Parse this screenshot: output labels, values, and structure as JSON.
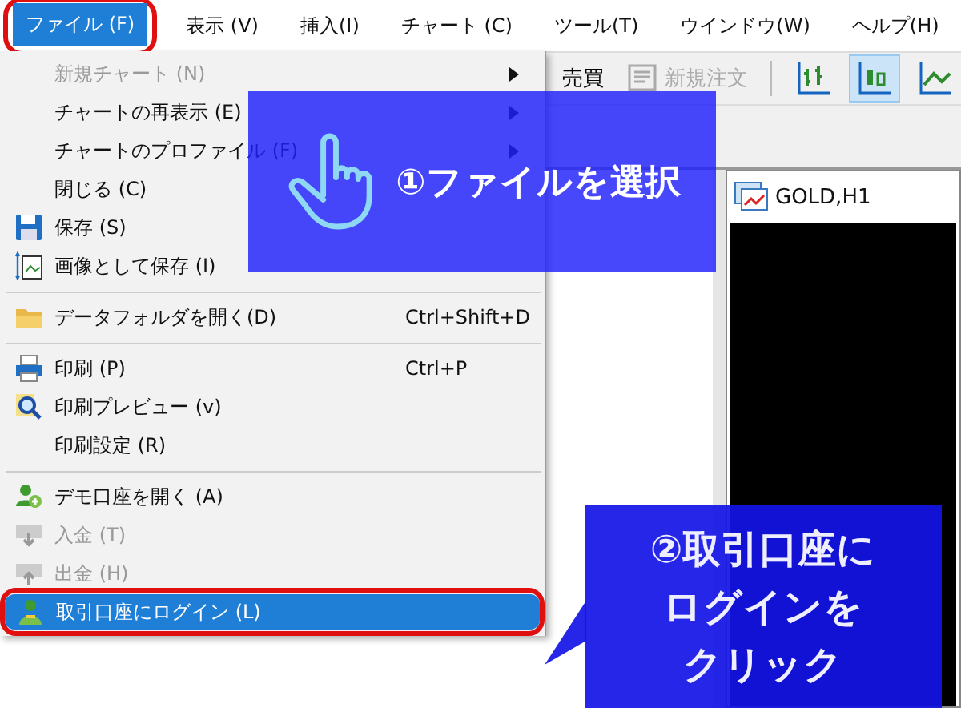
{
  "menubar": [
    {
      "label": "ファイル (F)",
      "selected": true,
      "annotated": true
    },
    {
      "label": "表示 (V)",
      "selected": false,
      "annotated": false
    },
    {
      "label": "挿入(I)",
      "selected": false,
      "annotated": false
    },
    {
      "label": "チャート (C)",
      "selected": false,
      "annotated": false
    },
    {
      "label": "ツール(T)",
      "selected": false,
      "annotated": false
    },
    {
      "label": "ウインドウ(W)",
      "selected": false,
      "annotated": false
    },
    {
      "label": "ヘルプ(H)",
      "selected": false,
      "annotated": false
    }
  ],
  "toolbar": {
    "trade_label": "売買",
    "new_order": {
      "label": "新規注文",
      "disabled": true
    },
    "chart_types": [
      {
        "kind": "bar",
        "selected": false
      },
      {
        "kind": "candle",
        "selected": true
      },
      {
        "kind": "line",
        "selected": false
      }
    ]
  },
  "chart_window": {
    "title": "GOLD,H1"
  },
  "file_menu": {
    "items": [
      {
        "kind": "item",
        "label": "新規チャート (N)",
        "submenu": true,
        "disabled": true,
        "selected": false,
        "annotated": false
      },
      {
        "kind": "item",
        "label": "チャートの再表示 (E)",
        "submenu": true,
        "disabled": false,
        "selected": false,
        "annotated": false
      },
      {
        "kind": "item",
        "label": "チャートのプロファイル (F)",
        "submenu": true,
        "disabled": false,
        "selected": false,
        "annotated": false
      },
      {
        "kind": "item",
        "label": "閉じる (C)",
        "submenu": false,
        "disabled": false,
        "selected": false,
        "annotated": false
      },
      {
        "kind": "item",
        "label": "保存 (S)",
        "submenu": false,
        "disabled": false,
        "selected": false,
        "annotated": false
      },
      {
        "kind": "item",
        "label": "画像として保存 (I)",
        "submenu": false,
        "disabled": false,
        "selected": false,
        "annotated": false
      },
      {
        "kind": "separator"
      },
      {
        "kind": "item",
        "label": "データフォルダを開く(D)",
        "shortcut": "Ctrl+Shift+D",
        "submenu": false,
        "disabled": false,
        "selected": false,
        "annotated": false
      },
      {
        "kind": "separator"
      },
      {
        "kind": "item",
        "label": "印刷 (P)",
        "shortcut": "Ctrl+P",
        "submenu": false,
        "disabled": false,
        "selected": false,
        "annotated": false
      },
      {
        "kind": "item",
        "label": "印刷プレビュー (v)",
        "submenu": false,
        "disabled": false,
        "selected": false,
        "annotated": false
      },
      {
        "kind": "item",
        "label": "印刷設定 (R)",
        "submenu": false,
        "disabled": false,
        "selected": false,
        "annotated": false
      },
      {
        "kind": "separator"
      },
      {
        "kind": "item",
        "label": "デモ口座を開く (A)",
        "submenu": false,
        "disabled": false,
        "selected": false,
        "annotated": false
      },
      {
        "kind": "item",
        "label": "入金 (T)",
        "submenu": false,
        "disabled": true,
        "selected": false,
        "annotated": false
      },
      {
        "kind": "item",
        "label": "出金 (H)",
        "submenu": false,
        "disabled": true,
        "selected": false,
        "annotated": false
      },
      {
        "kind": "item",
        "label": "取引口座にログイン (L)",
        "submenu": false,
        "disabled": false,
        "selected": true,
        "annotated": true
      }
    ]
  },
  "callout_1": {
    "text": "①ファイルを選択"
  },
  "callout_2": {
    "lines": [
      "②取引口座に",
      "ログインを",
      "クリック"
    ]
  }
}
